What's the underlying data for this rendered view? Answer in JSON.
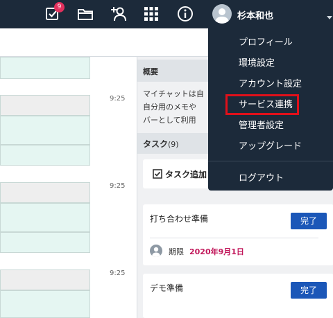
{
  "topbar": {
    "task_badge": "9",
    "icons": [
      "task-check-icon",
      "folder-icon",
      "add-contact-icon",
      "apps-grid-icon",
      "info-icon"
    ]
  },
  "user": {
    "name": "杉本和也"
  },
  "menu": {
    "items": [
      {
        "label": "プロフィール"
      },
      {
        "label": "環境設定"
      },
      {
        "label": "アカウント設定"
      },
      {
        "label": "サービス連携"
      },
      {
        "label": "管理者設定"
      },
      {
        "label": "アップグレード"
      }
    ],
    "logout": "ログアウト",
    "highlighted_item": "サービス連携",
    "highlight_color": "#e0101a"
  },
  "chat": {
    "times": [
      "9:25",
      "9:25",
      "9:25"
    ]
  },
  "side": {
    "overview_title": "概要",
    "overview_lines": [
      "マイチャットは自",
      "自分用のメモや",
      "バーとして利用"
    ],
    "task_title": "タスク",
    "task_count": "(9)",
    "add_task_label": "タスク追加",
    "tasks": [
      {
        "name": "打ち合わせ準備",
        "done_label": "完了",
        "due_label": "期限",
        "due_date": "2020年9月1日"
      },
      {
        "name": "デモ準備",
        "done_label": "完了"
      }
    ]
  },
  "colors": {
    "topbar": "#1c2a3a",
    "badge": "#e2305d",
    "done_button": "#1b57b8",
    "due_date": "#c2185b"
  }
}
